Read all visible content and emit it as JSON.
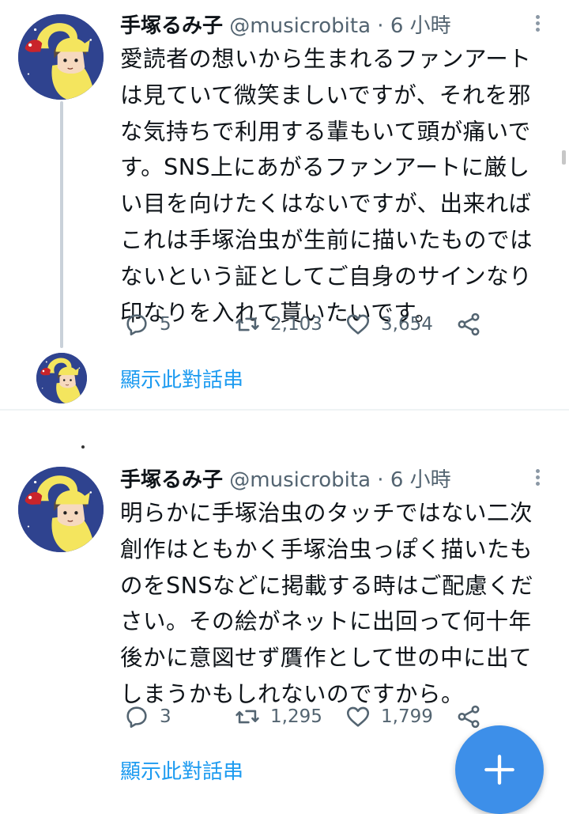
{
  "tweets": [
    {
      "author_name": "手塚るみ子",
      "handle": "@musicrobita",
      "separator": "·",
      "time": "6 小時",
      "body": "愛読者の想いから生まれるファンアートは見ていて微笑ましいですが、それを邪な気持ちで利用する輩もいて頭が痛いです。SNS上にあがるファンアートに厳しい目を向けたくはないですが、出来ればこれは手塚治虫が生前に描いたものではないという証としてご自身のサインなり印なりを入れて貰いたいです。",
      "replies": "5",
      "retweets": "2,103",
      "likes": "3,654",
      "show_thread": "顯示此對話串"
    },
    {
      "author_name": "手塚るみ子",
      "handle": "@musicrobita",
      "separator": "·",
      "time": "6 小時",
      "body": "明らかに手塚治虫のタッチではない二次創作はともかく手塚治虫っぽく描いたものをSNSなどに掲載する時はご配慮ください。その絵がネットに出回って何十年後かに意図せず贋作として世の中に出てしまうかもしれないのですから。",
      "replies": "3",
      "retweets": "1,295",
      "likes": "1,799",
      "show_thread": "顯示此對話串"
    }
  ],
  "icons": {
    "reply": "reply-icon",
    "retweet": "retweet-icon",
    "like": "heart-icon",
    "share": "share-icon",
    "more": "more-vertical-icon",
    "compose": "plus-icon"
  },
  "colors": {
    "accent": "#1d9bf0",
    "fab": "#3d8fe9",
    "text": "#0f1419",
    "secondary": "#536471"
  }
}
